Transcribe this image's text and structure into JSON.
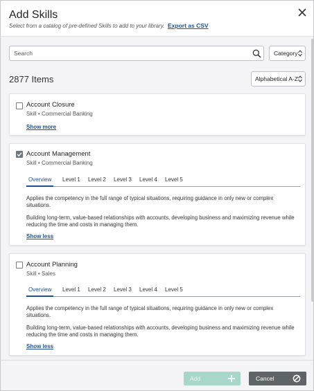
{
  "header": {
    "title": "Add Skills",
    "subtitle": "Select from a catalog of pre-defined Skills to add to your library.",
    "export_label": "Export as CSV"
  },
  "toolbar": {
    "search_placeholder": "Search",
    "category_label": "Category",
    "count_label": "2877 Items",
    "sort_label": "Alphabetical A-Z"
  },
  "skills": [
    {
      "name": "Account Closure",
      "type": "Skill",
      "category": "Commercial Banking",
      "checked": false,
      "toggle_label": "Show more"
    },
    {
      "name": "Account Management",
      "type": "Skill",
      "category": "Commercial Banking",
      "checked": true,
      "tabs": [
        "Overview",
        "Level 1",
        "Level 2",
        "Level 3",
        "Level 4",
        "Level 5"
      ],
      "active_tab": "Overview",
      "paragraph_1": "Applies the competency in the full range of typical situations, requiring guidance in only new or complex situations.",
      "paragraph_2": "Building long-term, value-based relationships with accounts, developing business and maximizing revenue while reducing the time and costs in managing them.",
      "toggle_label": "Show less"
    },
    {
      "name": "Account Planning",
      "type": "Skill",
      "category": "Sales",
      "checked": false,
      "tabs": [
        "Overview",
        "Level 1",
        "Level 2",
        "Level 3",
        "Level 4",
        "Level 5"
      ],
      "active_tab": "Overview",
      "paragraph_1": "Applies the competency in the full range of typical situations, requiring guidance in only new or complex situations.",
      "paragraph_2": "Building long-term, value-based relationships with accounts, developing business and maximizing revenue while reducing the time and costs in managing them.",
      "toggle_label": "Show less"
    }
  ],
  "footer": {
    "add_label": "Add",
    "cancel_label": "Cancel"
  },
  "colors": {
    "link": "#1d4f91",
    "add_button_disabled": "#a9d6ca",
    "cancel_button": "#5f6468"
  },
  "icons": [
    "close-icon",
    "search-icon",
    "updown-icon",
    "checkmark-icon",
    "plus-icon",
    "cancel-icon"
  ]
}
